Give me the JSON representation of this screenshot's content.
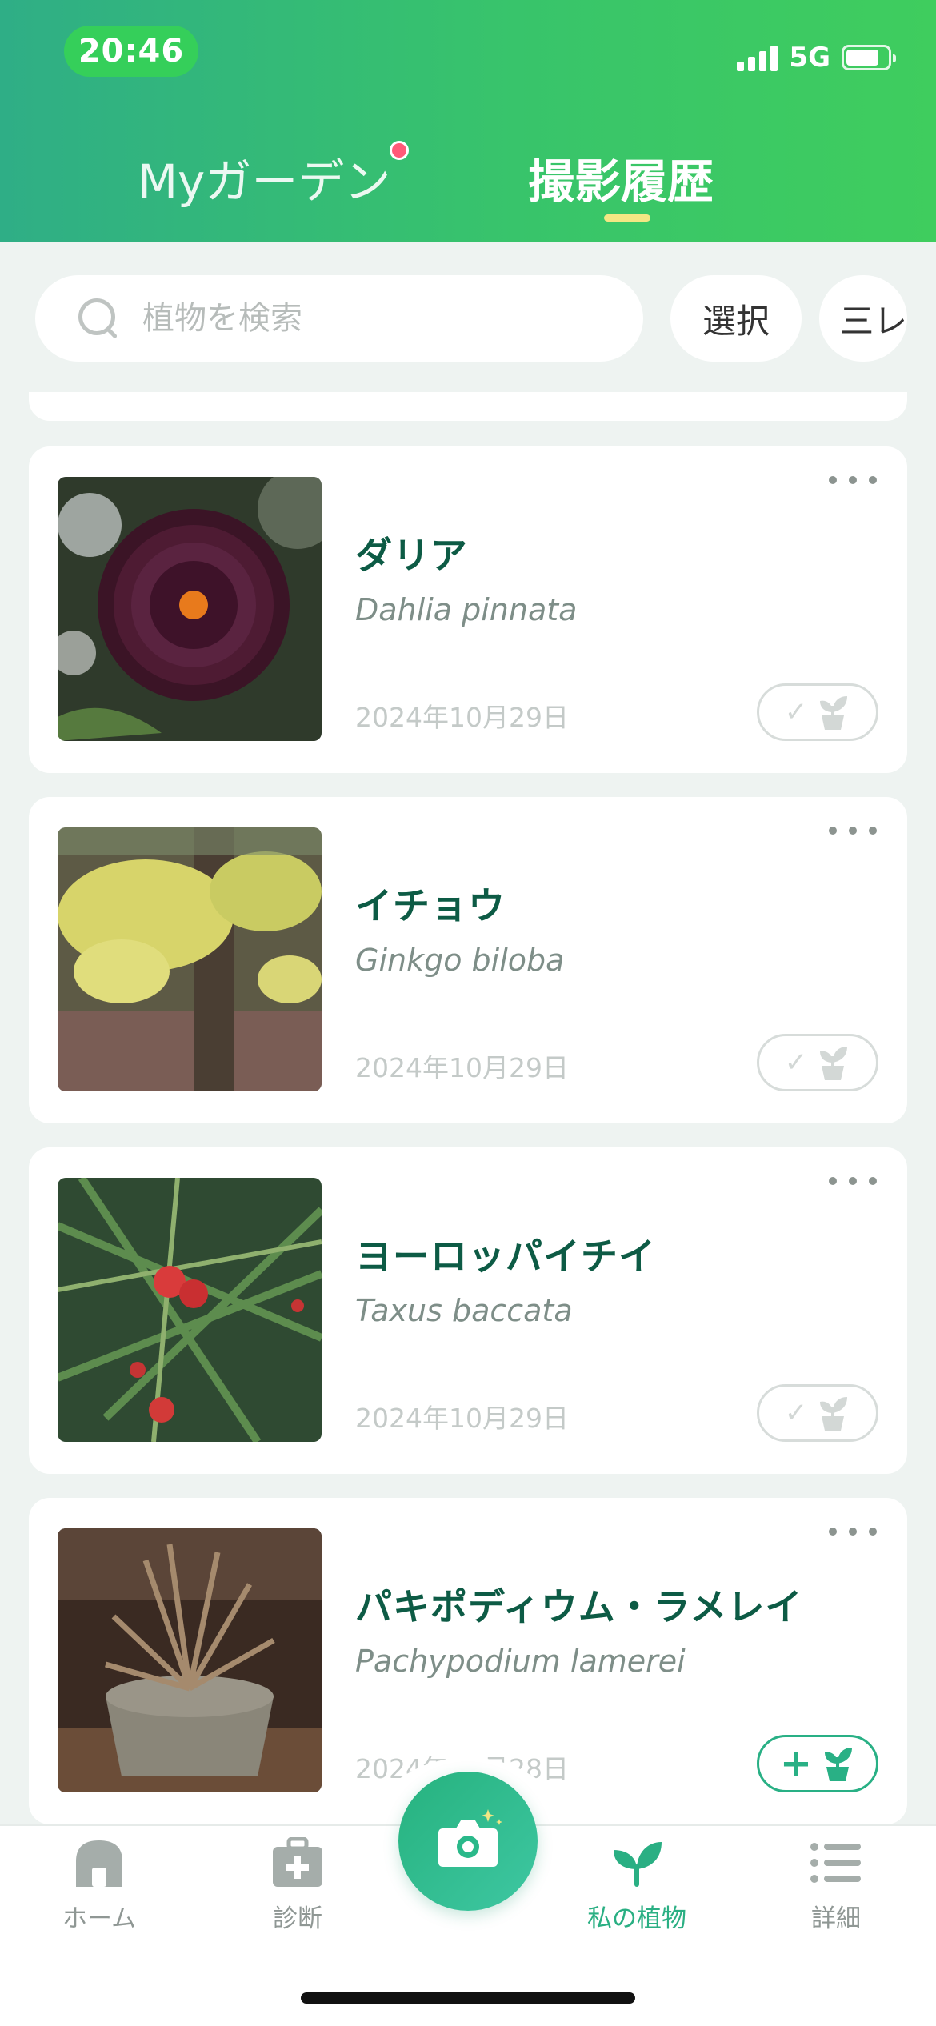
{
  "status_bar": {
    "time": "20:46",
    "network": "5G"
  },
  "tabs": [
    {
      "label": "Myガーデン",
      "active": false,
      "has_badge": true
    },
    {
      "label": "撮影履歴",
      "active": true
    }
  ],
  "search": {
    "placeholder": "植物を検索",
    "value": ""
  },
  "toolbar": {
    "select_label": "選択",
    "sort_label": "三レ"
  },
  "history": [
    {
      "name": "ダリア",
      "scientific": "Dahlia pinnata",
      "date": "2024年10月29日",
      "in_garden": true
    },
    {
      "name": "イチョウ",
      "scientific": "Ginkgo biloba",
      "date": "2024年10月29日",
      "in_garden": true
    },
    {
      "name": "ヨーロッパイチイ",
      "scientific": "Taxus baccata",
      "date": "2024年10月29日",
      "in_garden": true
    },
    {
      "name": "パキポディウム・ラメレイ",
      "scientific": "Pachypodium lamerei",
      "date": "2024年10月28日",
      "in_garden": false
    }
  ],
  "bottom_nav": {
    "items": [
      {
        "label": "ホーム",
        "icon": "home-icon"
      },
      {
        "label": "診断",
        "icon": "medical-kit-icon"
      },
      {
        "label": "",
        "icon": "camera-icon"
      },
      {
        "label": "私の植物",
        "icon": "sprout-icon",
        "active": true
      },
      {
        "label": "詳細",
        "icon": "list-icon"
      }
    ]
  },
  "colors": {
    "brand_green": "#2aaf83",
    "header_start": "#2fae86",
    "header_end": "#3fcd5e",
    "name_text": "#0d5b45",
    "tab_underline": "#f3e784"
  }
}
